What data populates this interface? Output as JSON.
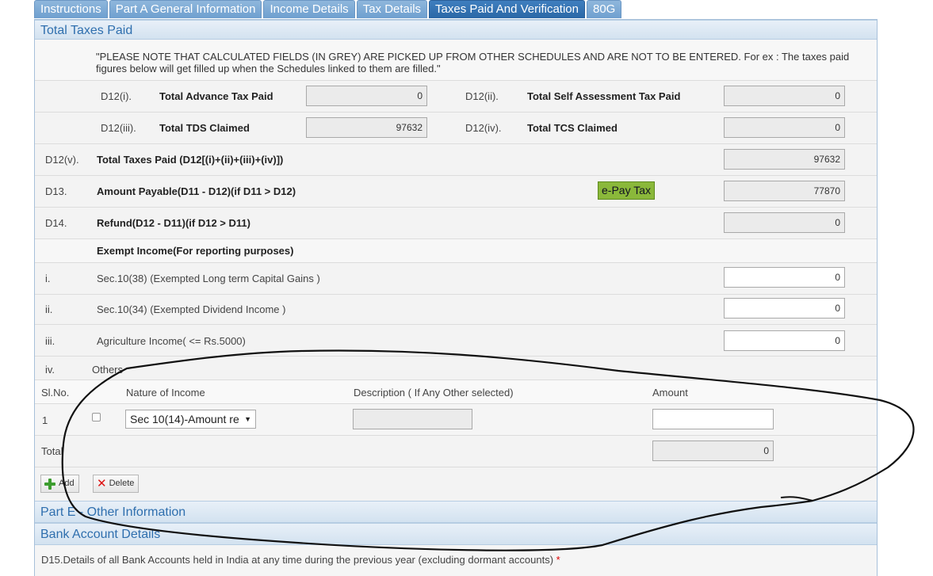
{
  "tabs": [
    {
      "label": "Instructions",
      "active": false
    },
    {
      "label": "Part A General Information",
      "active": false
    },
    {
      "label": "Income Details",
      "active": false
    },
    {
      "label": "Tax Details",
      "active": false
    },
    {
      "label": "Taxes Paid And Verification",
      "active": true
    },
    {
      "label": "80G",
      "active": false
    }
  ],
  "total_taxes_paid": {
    "heading": "Total Taxes Paid",
    "note": "\"PLEASE NOTE THAT CALCULATED FIELDS (IN GREY) ARE PICKED UP FROM OTHER SCHEDULES AND ARE NOT TO BE ENTERED. For ex : The taxes paid figures below will get filled up when the Schedules linked to them are filled.\"",
    "d12i": {
      "code": "D12(i).",
      "label": "Total Advance Tax Paid",
      "value": "0"
    },
    "d12ii": {
      "code": "D12(ii).",
      "label": "Total Self Assessment Tax Paid",
      "value": "0"
    },
    "d12iii": {
      "code": "D12(iii).",
      "label": "Total TDS Claimed",
      "value": "97632"
    },
    "d12iv": {
      "code": "D12(iv).",
      "label": "Total TCS Claimed",
      "value": "0"
    },
    "d12v": {
      "code": "D12(v).",
      "label": "Total Taxes Paid (D12[(i)+(ii)+(iii)+(iv)])",
      "value": "97632"
    },
    "d13": {
      "code": "D13.",
      "label": "Amount Payable(D11 - D12)(if D11 > D12)",
      "value": "77870",
      "pay_button": "e-Pay Tax"
    },
    "d14": {
      "code": "D14.",
      "label": "Refund(D12 - D11)(if D12 > D11)",
      "value": "0"
    }
  },
  "exempt_income": {
    "heading": "Exempt Income(For reporting purposes)",
    "items": [
      {
        "code": "i.",
        "label": "Sec.10(38) (Exempted Long term Capital Gains )",
        "value": "0"
      },
      {
        "code": "ii.",
        "label": "Sec.10(34) (Exempted Dividend Income )",
        "value": "0"
      },
      {
        "code": "iii.",
        "label": "Agriculture Income( <= Rs.5000)",
        "value": "0"
      }
    ],
    "others_code": "iv.",
    "others_label": "Others",
    "table": {
      "headers": {
        "slno": "Sl.No.",
        "nature": "Nature of Income",
        "description": "Description ( If Any Other selected)",
        "amount": "Amount"
      },
      "rows": [
        {
          "slno": "1",
          "nature": "Sec 10(14)-Amount re",
          "description": "",
          "amount": ""
        }
      ],
      "total_label": "Total",
      "total_value": "0"
    },
    "add_button": "Add",
    "delete_button": "Delete"
  },
  "part_e": {
    "heading": "Part E - Other Information"
  },
  "bank": {
    "heading": "Bank Account Details",
    "d15": "D15.Details of all Bank Accounts held in India at any time during the previous year (excluding dormant accounts)",
    "required_mark": "*"
  }
}
